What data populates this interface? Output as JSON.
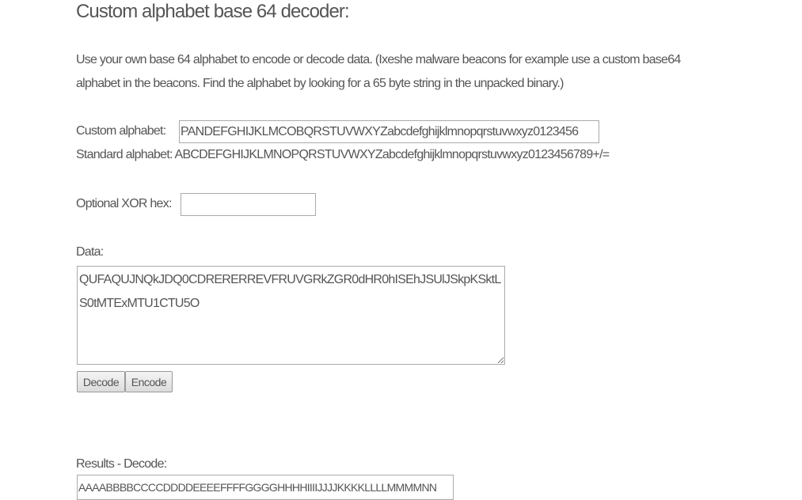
{
  "title": "Custom alphabet base 64 decoder:",
  "intro": "Use your own base 64 alphabet to encode or decode data. (Ixeshe malware beacons for example use a custom base64 alphabet in the beacons. Find the alphabet by looking for a 65 byte string in the unpacked binary.)",
  "custom_alphabet": {
    "label": "Custom alphabet:",
    "value": "PANDEFGHIJKLMCOBQRSTUVWXYZabcdefghijklmnopqrstuvwxyz0123456"
  },
  "standard_alphabet": {
    "label": "Standard alphabet:",
    "value": "ABCDEFGHIJKLMNOPQRSTUVWXYZabcdefghijklmnopqrstuvwxyz0123456789+/="
  },
  "xor": {
    "label": "Optional XOR hex:",
    "value": ""
  },
  "data": {
    "label": "Data:",
    "value": "QUFAQUJNQkJDQ0CDRERERREVFRUVGRkZGR0dHR0hISEhJSUlJSkpKSktLS0tMTExMTU1CTU5O"
  },
  "buttons": {
    "decode": "Decode",
    "encode": "Encode"
  },
  "results": {
    "label": "Results - Decode:",
    "value": "AAAABBBBCCCCDDDDEEEEFFFFGGGGHHHHIIIIJJJJKKKKLLLLMMMMNN"
  }
}
